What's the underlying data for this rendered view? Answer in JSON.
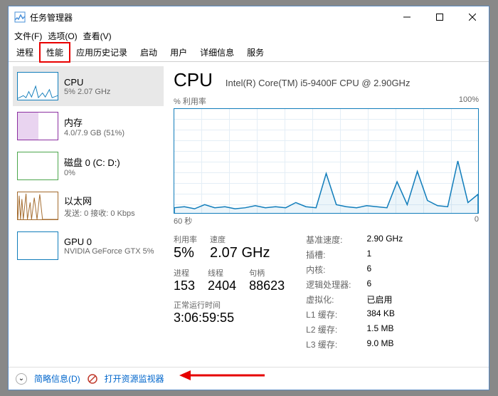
{
  "window": {
    "title": "任务管理器"
  },
  "menu": {
    "file": "文件(F)",
    "options": "选项(O)",
    "view": "查看(V)"
  },
  "tabs": [
    "进程",
    "性能",
    "应用历史记录",
    "启动",
    "用户",
    "详细信息",
    "服务"
  ],
  "active_tab": 1,
  "sidebar": [
    {
      "title": "CPU",
      "sub": "5% 2.07 GHz"
    },
    {
      "title": "内存",
      "sub": "4.0/7.9 GB (51%)"
    },
    {
      "title": "磁盘 0 (C: D:)",
      "sub": "0%"
    },
    {
      "title": "以太网",
      "sub": "发送: 0 接收: 0 Kbps"
    },
    {
      "title": "GPU 0",
      "sub": "NVIDIA GeForce GTX   5%"
    }
  ],
  "main": {
    "title": "CPU",
    "subtitle": "Intel(R) Core(TM) i5-9400F CPU @ 2.90GHz",
    "chart_ylabel": "% 利用率",
    "chart_ymax": "100%",
    "chart_xl": "60 秒",
    "chart_xr": "0",
    "stats": {
      "util_label": "利用率",
      "util": "5%",
      "speed_label": "速度",
      "speed": "2.07 GHz",
      "proc_label": "进程",
      "proc": "153",
      "thread_label": "线程",
      "thread": "2404",
      "handle_label": "句柄",
      "handle": "88623",
      "uptime_label": "正常运行时间",
      "uptime": "3:06:59:55"
    },
    "right": [
      {
        "k": "基准速度:",
        "v": "2.90 GHz"
      },
      {
        "k": "插槽:",
        "v": "1"
      },
      {
        "k": "内核:",
        "v": "6"
      },
      {
        "k": "逻辑处理器:",
        "v": "6"
      },
      {
        "k": "虚拟化:",
        "v": "已启用"
      },
      {
        "k": "L1 缓存:",
        "v": "384 KB"
      },
      {
        "k": "L2 缓存:",
        "v": "1.5 MB"
      },
      {
        "k": "L3 缓存:",
        "v": "9.0 MB"
      }
    ]
  },
  "footer": {
    "brief": "简略信息(D)",
    "resmon": "打开资源监视器"
  },
  "chart_data": {
    "type": "line",
    "title": "% 利用率",
    "xlabel": "秒",
    "ylabel": "% 利用率",
    "xlim": [
      60,
      0
    ],
    "ylim": [
      0,
      100
    ],
    "x": [
      60,
      58,
      56,
      54,
      52,
      50,
      48,
      46,
      44,
      42,
      40,
      38,
      36,
      34,
      32,
      30,
      28,
      26,
      24,
      22,
      20,
      18,
      16,
      14,
      12,
      10,
      8,
      6,
      4,
      2,
      0
    ],
    "values": [
      5,
      6,
      4,
      8,
      5,
      6,
      4,
      5,
      7,
      5,
      6,
      5,
      10,
      6,
      5,
      38,
      8,
      6,
      5,
      7,
      6,
      5,
      30,
      8,
      40,
      12,
      7,
      6,
      50,
      10,
      18
    ]
  }
}
